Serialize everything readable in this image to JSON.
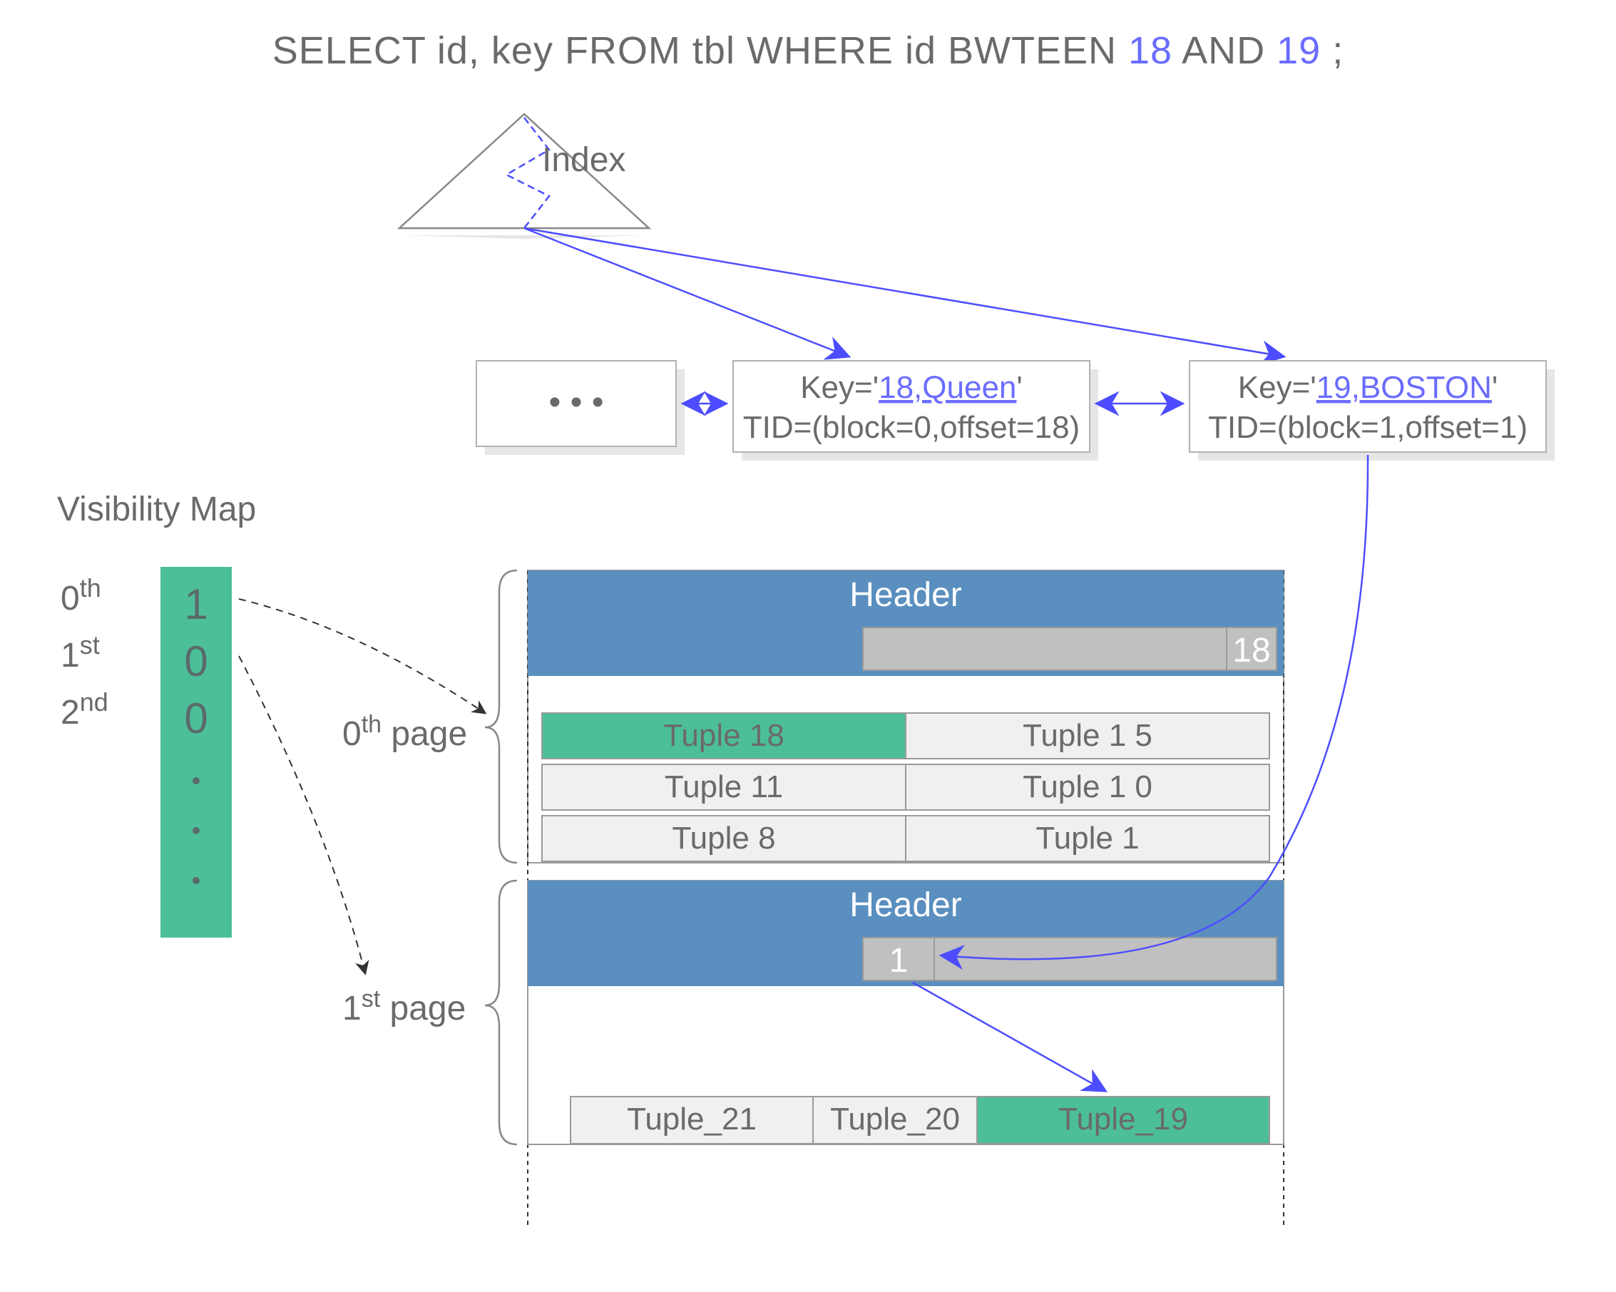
{
  "sql": {
    "prefix": "SELECT id, key FROM tbl WHERE  id  BWTEEN ",
    "val1": "18",
    "mid": "  AND  ",
    "val2": "19",
    "suffix": " ;"
  },
  "index": {
    "label": "Index",
    "leaf_ellipsis": "•    •    •",
    "leaf1_key_prefix": "Key='",
    "leaf1_key_hl": "18,Queen",
    "leaf1_key_suffix": "'",
    "leaf1_tid": "TID=(block=0,offset=18)",
    "leaf2_key_prefix": "Key='",
    "leaf2_key_hl": "19,BOSTON",
    "leaf2_key_suffix": "'",
    "leaf2_tid": "TID=(block=1,offset=1)"
  },
  "vm": {
    "title": "Visibility Map",
    "ord0_num": "0",
    "ord0_suf": "th",
    "ord1_num": "1",
    "ord1_suf": "st",
    "ord2_num": "2",
    "ord2_suf": "nd",
    "bit0": "1",
    "bit1": "0",
    "bit2": "0"
  },
  "pages": {
    "page0_label_num": "0",
    "page0_label_suf": "th",
    "page0_label_word": " page",
    "page1_label_num": "1",
    "page1_label_suf": "st",
    "page1_label_word": " page",
    "header": "Header",
    "slot18": "18",
    "slot1": "1",
    "t18": "Tuple 18",
    "t15": "Tuple 1 5",
    "t11": "Tuple 11",
    "t10": "Tuple 1 0",
    "t8": "Tuple 8",
    "t1": "Tuple 1",
    "t21": "Tuple_21",
    "t20": "Tuple_20",
    "t19": "Tuple_19"
  }
}
